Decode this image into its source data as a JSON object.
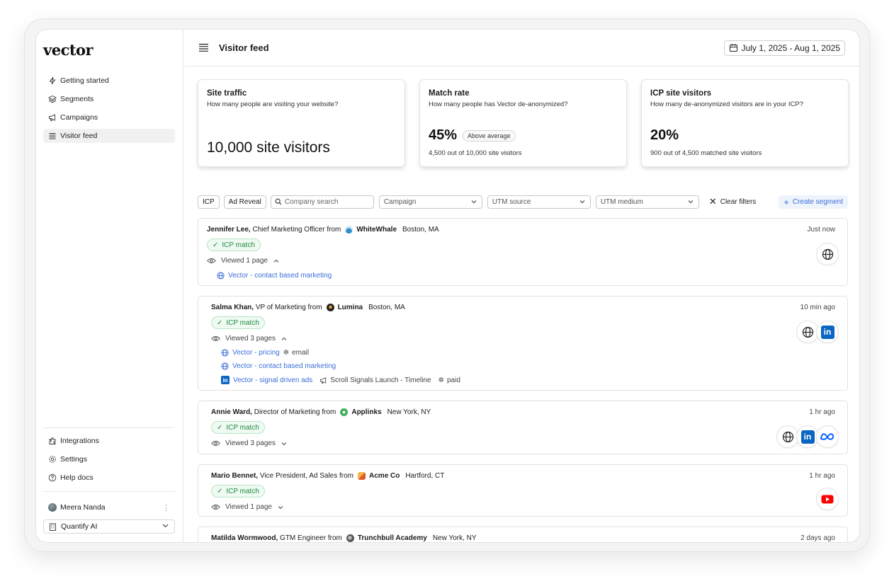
{
  "sidebar": {
    "logo": "vector",
    "nav": [
      {
        "label": "Getting started",
        "icon": "bolt-icon"
      },
      {
        "label": "Segments",
        "icon": "layers-icon"
      },
      {
        "label": "Campaigns",
        "icon": "megaphone-icon"
      },
      {
        "label": "Visitor feed",
        "icon": "list-icon",
        "active": true
      }
    ],
    "bottom_nav": [
      {
        "label": "Integrations",
        "icon": "integrations-icon"
      },
      {
        "label": "Settings",
        "icon": "gear-icon"
      },
      {
        "label": "Help docs",
        "icon": "help-icon"
      }
    ],
    "user_name": "Meera Nanda",
    "org_name": "Quantify AI"
  },
  "header": {
    "title": "Visitor feed",
    "date_range": "July 1, 2025 - Aug 1, 2025"
  },
  "stats": [
    {
      "title": "Site traffic",
      "desc": "How many people are visiting your website?",
      "value": "10,000 site visitors"
    },
    {
      "title": "Match rate",
      "desc": "How many people has Vector de-anonymized?",
      "value": "45%",
      "badge": "Above average",
      "sub": "4,500 out of 10,000 site visitors"
    },
    {
      "title": "ICP site visitors",
      "desc": "How many de-anonymized visitors are in your ICP?",
      "value": "20%",
      "sub": "900 out of 4,500 matched site visitors"
    }
  ],
  "filters": {
    "chips": [
      "ICP",
      "Ad Reveal"
    ],
    "search_placeholder": "Company search",
    "selects": [
      "Campaign",
      "UTM source",
      "UTM medium"
    ],
    "clear_label": "Clear filters",
    "create_label": "Create segment"
  },
  "feed": [
    {
      "name": "Jennifer Lee,",
      "role": "Chief Marketing Officer from",
      "company": "WhiteWhale",
      "company_color": "#3aa0d8",
      "location": "Boston, MA",
      "time": "Just now",
      "icp": "ICP match",
      "viewed": "Viewed 1 page",
      "pages": [
        {
          "label": "Vector - contact based marketing",
          "icon": "globe-icon"
        }
      ],
      "sources": [
        "web"
      ]
    },
    {
      "name": "Salma Khan,",
      "role": "VP of Marketing from",
      "company": "Lumina",
      "company_color": "#2b2b2b",
      "location": "Boston, MA",
      "time": "10 min ago",
      "icp": "ICP match",
      "viewed": "Viewed 3 pages",
      "pages": [
        {
          "label": "Vector - pricing",
          "icon": "globe-icon",
          "extra": "email"
        },
        {
          "label": "Vector - contact based marketing",
          "icon": "globe-icon"
        },
        {
          "label": "Vector - signal driven ads",
          "icon": "linkedin-icon",
          "campaign": "Scroll Signals Launch - Timeline",
          "extra": "paid"
        }
      ],
      "sources": [
        "web",
        "linkedin"
      ]
    },
    {
      "name": "Annie Ward,",
      "role": "Director of Marketing from",
      "company": "Applinks",
      "company_color": "#3fae5a",
      "location": "New York, NY",
      "time": "1 hr ago",
      "icp": "ICP match",
      "viewed": "Viewed 3 pages",
      "sources": [
        "web",
        "linkedin",
        "meta"
      ]
    },
    {
      "name": "Mario Bennet,",
      "role": "Vice President, Ad Sales from",
      "company": "Acme Co",
      "company_color": "#e0582b",
      "location": "Hartford, CT",
      "time": "1 hr ago",
      "icp": "ICP match",
      "viewed": "Viewed 1 page",
      "sources": [
        "youtube"
      ]
    },
    {
      "name": "Matilda Wormwood,",
      "role": "GTM Engineer from",
      "company": "Trunchbull Academy",
      "company_color": "#555555",
      "location": "New York, NY",
      "time": "2 days ago"
    }
  ]
}
